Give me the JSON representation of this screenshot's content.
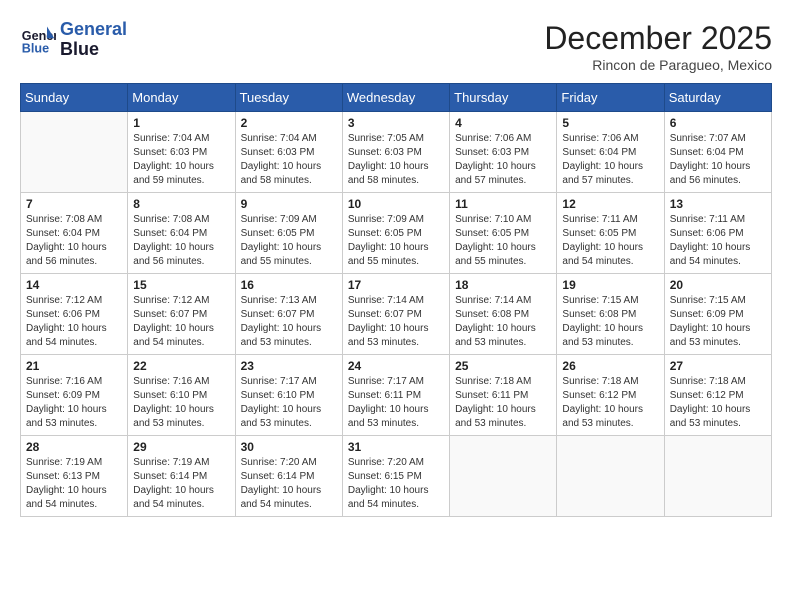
{
  "header": {
    "logo_line1": "General",
    "logo_line2": "Blue",
    "month": "December 2025",
    "location": "Rincon de Paragueo, Mexico"
  },
  "weekdays": [
    "Sunday",
    "Monday",
    "Tuesday",
    "Wednesday",
    "Thursday",
    "Friday",
    "Saturday"
  ],
  "weeks": [
    [
      {
        "day": "",
        "info": ""
      },
      {
        "day": "1",
        "info": "Sunrise: 7:04 AM\nSunset: 6:03 PM\nDaylight: 10 hours\nand 59 minutes."
      },
      {
        "day": "2",
        "info": "Sunrise: 7:04 AM\nSunset: 6:03 PM\nDaylight: 10 hours\nand 58 minutes."
      },
      {
        "day": "3",
        "info": "Sunrise: 7:05 AM\nSunset: 6:03 PM\nDaylight: 10 hours\nand 58 minutes."
      },
      {
        "day": "4",
        "info": "Sunrise: 7:06 AM\nSunset: 6:03 PM\nDaylight: 10 hours\nand 57 minutes."
      },
      {
        "day": "5",
        "info": "Sunrise: 7:06 AM\nSunset: 6:04 PM\nDaylight: 10 hours\nand 57 minutes."
      },
      {
        "day": "6",
        "info": "Sunrise: 7:07 AM\nSunset: 6:04 PM\nDaylight: 10 hours\nand 56 minutes."
      }
    ],
    [
      {
        "day": "7",
        "info": "Sunrise: 7:08 AM\nSunset: 6:04 PM\nDaylight: 10 hours\nand 56 minutes."
      },
      {
        "day": "8",
        "info": "Sunrise: 7:08 AM\nSunset: 6:04 PM\nDaylight: 10 hours\nand 56 minutes."
      },
      {
        "day": "9",
        "info": "Sunrise: 7:09 AM\nSunset: 6:05 PM\nDaylight: 10 hours\nand 55 minutes."
      },
      {
        "day": "10",
        "info": "Sunrise: 7:09 AM\nSunset: 6:05 PM\nDaylight: 10 hours\nand 55 minutes."
      },
      {
        "day": "11",
        "info": "Sunrise: 7:10 AM\nSunset: 6:05 PM\nDaylight: 10 hours\nand 55 minutes."
      },
      {
        "day": "12",
        "info": "Sunrise: 7:11 AM\nSunset: 6:05 PM\nDaylight: 10 hours\nand 54 minutes."
      },
      {
        "day": "13",
        "info": "Sunrise: 7:11 AM\nSunset: 6:06 PM\nDaylight: 10 hours\nand 54 minutes."
      }
    ],
    [
      {
        "day": "14",
        "info": "Sunrise: 7:12 AM\nSunset: 6:06 PM\nDaylight: 10 hours\nand 54 minutes."
      },
      {
        "day": "15",
        "info": "Sunrise: 7:12 AM\nSunset: 6:07 PM\nDaylight: 10 hours\nand 54 minutes."
      },
      {
        "day": "16",
        "info": "Sunrise: 7:13 AM\nSunset: 6:07 PM\nDaylight: 10 hours\nand 53 minutes."
      },
      {
        "day": "17",
        "info": "Sunrise: 7:14 AM\nSunset: 6:07 PM\nDaylight: 10 hours\nand 53 minutes."
      },
      {
        "day": "18",
        "info": "Sunrise: 7:14 AM\nSunset: 6:08 PM\nDaylight: 10 hours\nand 53 minutes."
      },
      {
        "day": "19",
        "info": "Sunrise: 7:15 AM\nSunset: 6:08 PM\nDaylight: 10 hours\nand 53 minutes."
      },
      {
        "day": "20",
        "info": "Sunrise: 7:15 AM\nSunset: 6:09 PM\nDaylight: 10 hours\nand 53 minutes."
      }
    ],
    [
      {
        "day": "21",
        "info": "Sunrise: 7:16 AM\nSunset: 6:09 PM\nDaylight: 10 hours\nand 53 minutes."
      },
      {
        "day": "22",
        "info": "Sunrise: 7:16 AM\nSunset: 6:10 PM\nDaylight: 10 hours\nand 53 minutes."
      },
      {
        "day": "23",
        "info": "Sunrise: 7:17 AM\nSunset: 6:10 PM\nDaylight: 10 hours\nand 53 minutes."
      },
      {
        "day": "24",
        "info": "Sunrise: 7:17 AM\nSunset: 6:11 PM\nDaylight: 10 hours\nand 53 minutes."
      },
      {
        "day": "25",
        "info": "Sunrise: 7:18 AM\nSunset: 6:11 PM\nDaylight: 10 hours\nand 53 minutes."
      },
      {
        "day": "26",
        "info": "Sunrise: 7:18 AM\nSunset: 6:12 PM\nDaylight: 10 hours\nand 53 minutes."
      },
      {
        "day": "27",
        "info": "Sunrise: 7:18 AM\nSunset: 6:12 PM\nDaylight: 10 hours\nand 53 minutes."
      }
    ],
    [
      {
        "day": "28",
        "info": "Sunrise: 7:19 AM\nSunset: 6:13 PM\nDaylight: 10 hours\nand 54 minutes."
      },
      {
        "day": "29",
        "info": "Sunrise: 7:19 AM\nSunset: 6:14 PM\nDaylight: 10 hours\nand 54 minutes."
      },
      {
        "day": "30",
        "info": "Sunrise: 7:20 AM\nSunset: 6:14 PM\nDaylight: 10 hours\nand 54 minutes."
      },
      {
        "day": "31",
        "info": "Sunrise: 7:20 AM\nSunset: 6:15 PM\nDaylight: 10 hours\nand 54 minutes."
      },
      {
        "day": "",
        "info": ""
      },
      {
        "day": "",
        "info": ""
      },
      {
        "day": "",
        "info": ""
      }
    ]
  ]
}
